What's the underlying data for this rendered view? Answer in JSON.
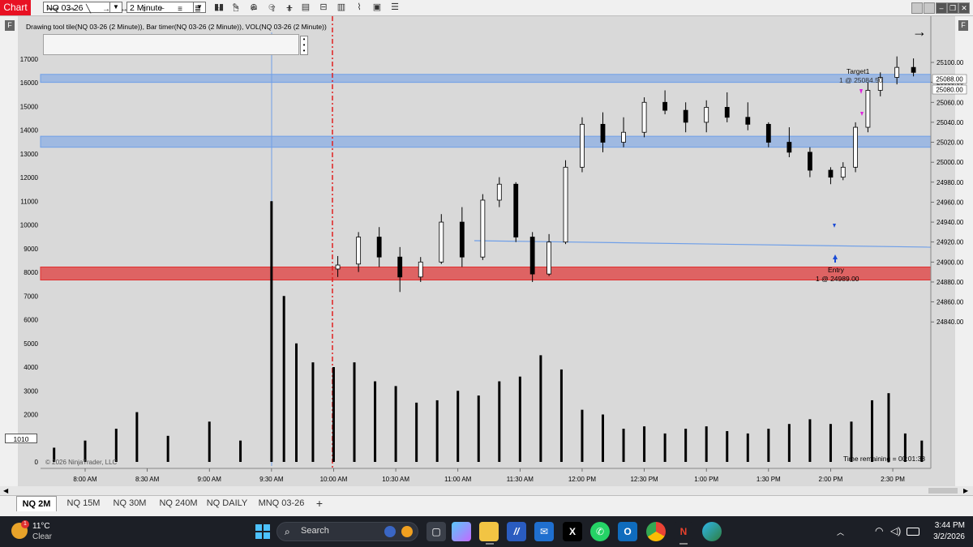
{
  "titlebar": {
    "app_label": "Chart",
    "instrument": "NQ 03-26",
    "interval": "2 Minute",
    "toolbar_icons": [
      "bar-style-icon",
      "pencil-icon",
      "zoom-in-icon",
      "zoom-out-icon",
      "crosshair-icon",
      "export-icon",
      "properties-icon",
      "indicators-icon",
      "strategy-icon",
      "data-box-icon",
      "list-icon"
    ],
    "window_icons": [
      "min-icon",
      "restore-icon",
      "close-icon"
    ]
  },
  "side": {
    "left_label": "F",
    "right_label": "F"
  },
  "chart": {
    "info_line": "Drawing tool tile(NQ 03-26 (2 Minute)), Bar timer(NQ 03-26 (2 Minute)), VOL(NQ 03-26 (2 Minute))",
    "copyright": "© 2026 NinjaTrader, LLC",
    "bar_timer": "Time remaining = 00:01:38",
    "volume_marker": "1010",
    "annotations": {
      "target_label": "Target1",
      "target_price": "1 @ 25084.50",
      "entry_label": "Entry",
      "entry_price": "1 @ 24989.00"
    }
  },
  "chart_data": {
    "type": "candlestick",
    "title": "",
    "price_axis": {
      "ticks": [
        "25100.00",
        "25080.00",
        "25060.00",
        "25040.00",
        "25020.00",
        "25000.00",
        "24980.00",
        "24960.00",
        "24940.00",
        "24920.00",
        "24900.00",
        "24880.00",
        "24860.00",
        "24840.00"
      ],
      "markers": [
        "25088.00",
        "25080.00"
      ]
    },
    "volume_axis": {
      "ticks": [
        "17000",
        "16000",
        "15000",
        "14000",
        "13000",
        "12000",
        "11000",
        "10000",
        "9000",
        "8000",
        "7000",
        "6000",
        "5000",
        "4000",
        "3000",
        "2000",
        "0"
      ]
    },
    "time_axis": {
      "ticks": [
        "8:00 AM",
        "8:30 AM",
        "9:00 AM",
        "9:30 AM",
        "10:00 AM",
        "10:30 AM",
        "11:00 AM",
        "11:30 AM",
        "12:00 PM",
        "12:30 PM",
        "1:00 PM",
        "1:30 PM",
        "2:00 PM",
        "2:30 PM"
      ]
    },
    "zones": [
      {
        "color": "#6f9fe8",
        "from": 25080,
        "to": 25088
      },
      {
        "color": "#6f9fe8",
        "from": 25015,
        "to": 25026
      },
      {
        "color": "#e03030",
        "from": 24882,
        "to": 24895
      }
    ],
    "price_candles": [
      [
        "10:02",
        24893,
        24906,
        24885,
        24897
      ],
      [
        "10:12",
        24898,
        24930,
        24890,
        24925
      ],
      [
        "10:22",
        24925,
        24935,
        24895,
        24905
      ],
      [
        "10:32",
        24905,
        24915,
        24870,
        24885
      ],
      [
        "10:42",
        24885,
        24905,
        24880,
        24900
      ],
      [
        "10:52",
        24900,
        24948,
        24898,
        24940
      ],
      [
        "11:02",
        24940,
        24955,
        24895,
        24905
      ],
      [
        "11:12",
        24905,
        24968,
        24902,
        24962
      ],
      [
        "11:20",
        24962,
        24985,
        24955,
        24978
      ],
      [
        "11:28",
        24978,
        24980,
        24920,
        24925
      ],
      [
        "11:36",
        24925,
        24930,
        24880,
        24888
      ],
      [
        "11:44",
        24888,
        24928,
        24886,
        24920
      ],
      [
        "11:52",
        24920,
        25002,
        24918,
        24995
      ],
      [
        "12:00",
        24995,
        25045,
        24990,
        25038
      ],
      [
        "12:10",
        25038,
        25050,
        25010,
        25020
      ],
      [
        "12:20",
        25020,
        25045,
        25015,
        25030
      ],
      [
        "12:30",
        25030,
        25065,
        25025,
        25060
      ],
      [
        "12:40",
        25060,
        25072,
        25048,
        25052
      ],
      [
        "12:50",
        25052,
        25060,
        25030,
        25040
      ],
      [
        "1:00",
        25040,
        25062,
        25030,
        25055
      ],
      [
        "1:10",
        25055,
        25070,
        25040,
        25045
      ],
      [
        "1:20",
        25045,
        25060,
        25032,
        25038
      ],
      [
        "1:30",
        25038,
        25040,
        25015,
        25020
      ],
      [
        "1:40",
        25020,
        25035,
        25005,
        25010
      ],
      [
        "1:50",
        25010,
        25015,
        24985,
        24992
      ],
      [
        "2:00",
        24992,
        24995,
        24978,
        24985
      ],
      [
        "2:06",
        24985,
        25000,
        24982,
        24995
      ],
      [
        "2:12",
        24995,
        25040,
        24990,
        25035
      ],
      [
        "2:18",
        25035,
        25080,
        25030,
        25072
      ],
      [
        "2:24",
        25072,
        25090,
        25066,
        25085
      ],
      [
        "2:32",
        25085,
        25106,
        25078,
        25095
      ],
      [
        "2:40",
        25095,
        25104,
        25086,
        25090
      ]
    ],
    "volume_bars": [
      [
        "7:45",
        600
      ],
      [
        "8:00",
        900
      ],
      [
        "8:15",
        1400
      ],
      [
        "8:25",
        2100
      ],
      [
        "8:40",
        1100
      ],
      [
        "9:00",
        1700
      ],
      [
        "9:15",
        900
      ],
      [
        "9:30",
        11000
      ],
      [
        "9:36",
        7000
      ],
      [
        "9:42",
        5000
      ],
      [
        "9:50",
        4200
      ],
      [
        "10:00",
        4000
      ],
      [
        "10:10",
        4200
      ],
      [
        "10:20",
        3400
      ],
      [
        "10:30",
        3200
      ],
      [
        "10:40",
        2500
      ],
      [
        "10:50",
        2600
      ],
      [
        "11:00",
        3000
      ],
      [
        "11:10",
        2800
      ],
      [
        "11:20",
        3400
      ],
      [
        "11:30",
        3600
      ],
      [
        "11:40",
        4500
      ],
      [
        "11:50",
        3900
      ],
      [
        "12:00",
        2200
      ],
      [
        "12:10",
        2000
      ],
      [
        "12:20",
        1400
      ],
      [
        "12:30",
        1500
      ],
      [
        "12:40",
        1200
      ],
      [
        "12:50",
        1400
      ],
      [
        "1:00",
        1500
      ],
      [
        "1:10",
        1300
      ],
      [
        "1:20",
        1200
      ],
      [
        "1:30",
        1400
      ],
      [
        "1:40",
        1600
      ],
      [
        "1:50",
        1800
      ],
      [
        "2:00",
        1600
      ],
      [
        "2:10",
        1700
      ],
      [
        "2:20",
        2600
      ],
      [
        "2:28",
        2900
      ],
      [
        "2:36",
        1200
      ],
      [
        "2:44",
        900
      ]
    ]
  },
  "tabs": [
    "NQ 2M",
    "NQ 15M",
    "NQ 30M",
    "NQ 240M",
    "NQ DAILY",
    "MNQ 03-26"
  ],
  "tab_add": "+",
  "taskbar": {
    "weather_temp": "11°C",
    "weather_desc": "Clear",
    "weather_badge": "1",
    "search_label": "Search",
    "time": "3:44 PM",
    "date": "3/2/2026",
    "apps": [
      "windows-start-icon",
      "search-icon",
      "task-view-icon",
      "copilot-icon",
      "file-explorer-icon",
      "trading-app-icon",
      "outlook-icon",
      "x-icon",
      "whatsapp-icon",
      "outlook-new-icon",
      "chrome-icon",
      "ninjatrader-icon",
      "edge-icon"
    ]
  }
}
